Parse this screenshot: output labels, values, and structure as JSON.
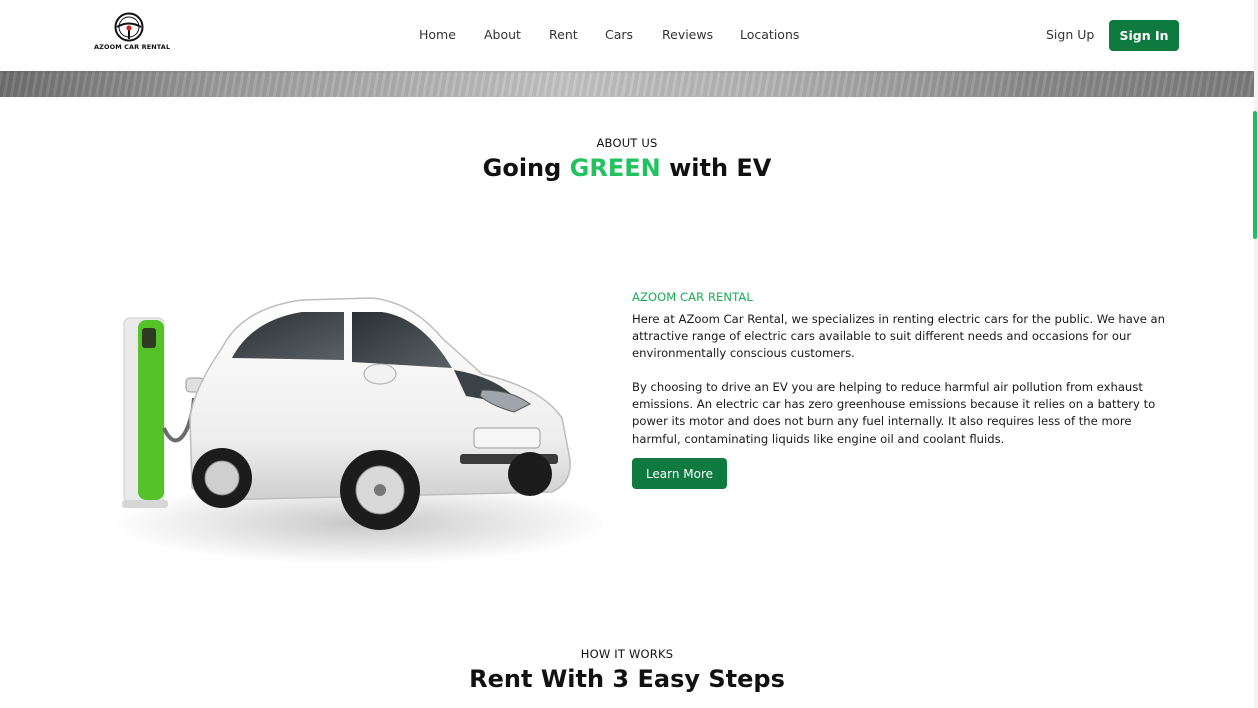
{
  "header": {
    "logo_text": "AZOOM CAR RENTAL",
    "nav": [
      "Home",
      "About",
      "Rent",
      "Cars",
      "Reviews",
      "Locations"
    ],
    "sign_up": "Sign Up",
    "sign_in": "Sign In"
  },
  "about": {
    "eyebrow": "ABOUT US",
    "title_before": "Going ",
    "title_highlight": "GREEN",
    "title_after": " with EV",
    "brand": "AZOOM CAR RENTAL",
    "paragraph1": "Here at AZoom Car Rental, we specializes in renting electric cars for the public. We have an attractive range of electric cars available to suit different needs and occasions for our environmentally conscious customers.",
    "paragraph2": "By choosing to drive an EV you are helping to reduce harmful air pollution from exhaust emissions. An electric car has zero greenhouse emissions because it relies on a battery to power its motor and does not burn any fuel internally. It also requires less of the more harmful, contaminating liquids like engine oil and coolant fluids.",
    "button": "Learn More"
  },
  "how_it_works": {
    "eyebrow": "HOW IT WORKS",
    "title": "Rent With 3 Easy Steps"
  },
  "colors": {
    "brand_green": "#0f7a3f",
    "accent_green": "#22c261",
    "charger_green": "#55c22a"
  }
}
